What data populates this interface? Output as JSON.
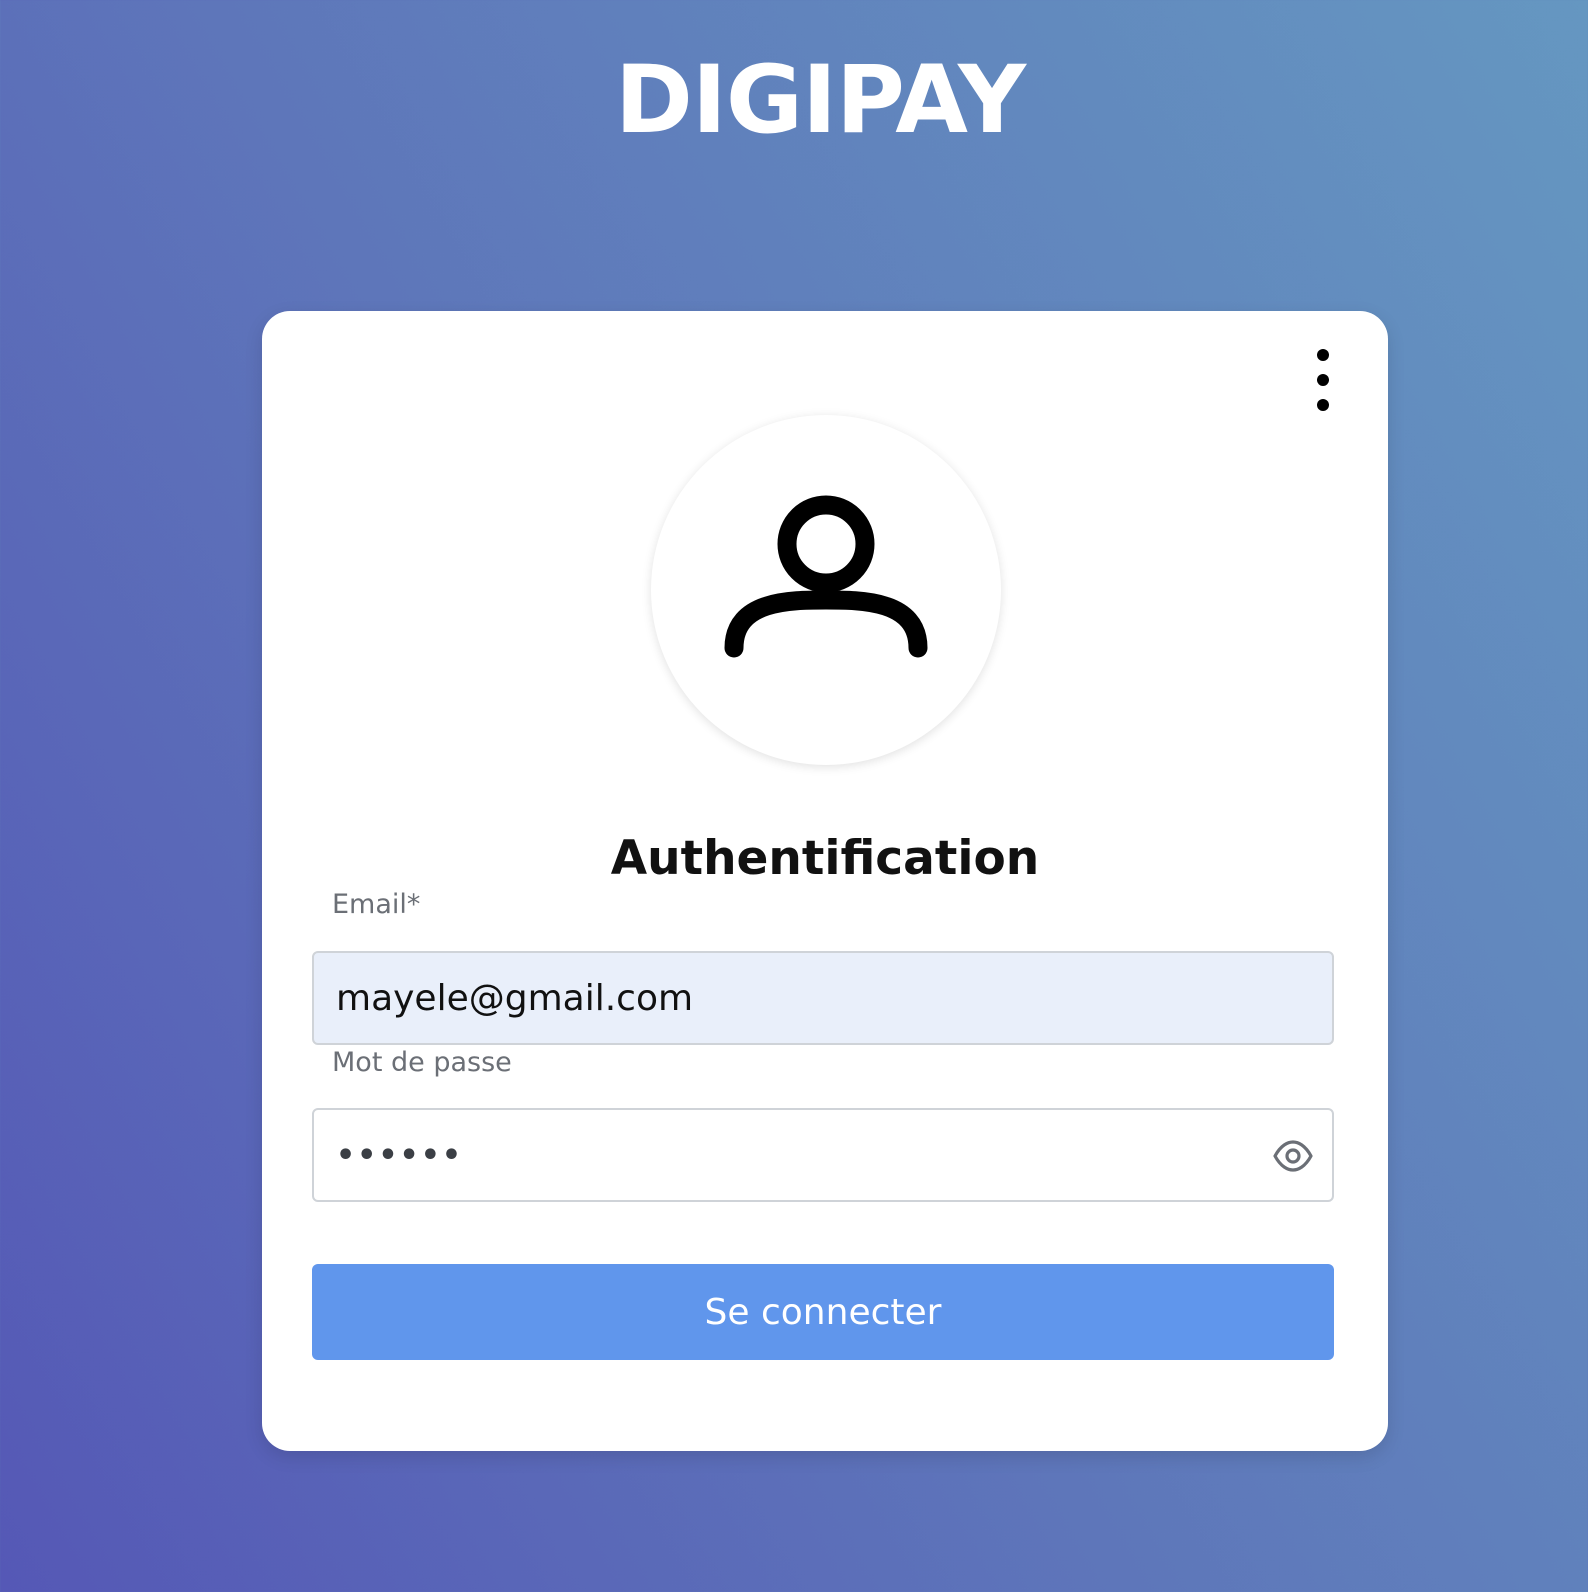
{
  "app": {
    "title": "DIGIPAY"
  },
  "login": {
    "title": "Authentification",
    "menu_icon": "more-vertical-icon",
    "avatar_icon": "user-icon",
    "email": {
      "label": "Email*",
      "value": "mayele@gmail.com"
    },
    "password": {
      "label": "Mot de passe",
      "masked_value": "••••••",
      "toggle_icon": "eye-icon"
    },
    "submit_label": "Se connecter"
  },
  "colors": {
    "background_gradient_start": "#5558b6",
    "background_gradient_end": "#6597c1",
    "button": "#6096ec",
    "email_field_bg": "#e9effa"
  }
}
